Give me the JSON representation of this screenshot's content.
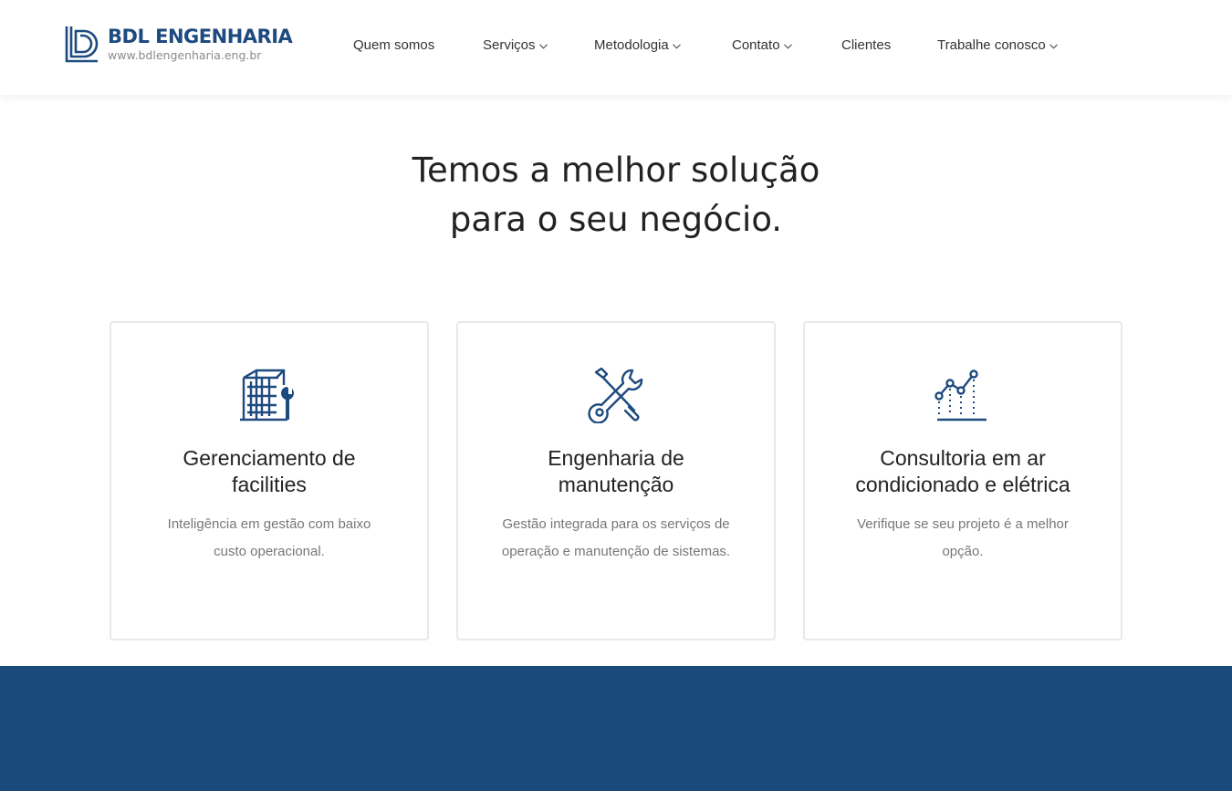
{
  "brand": {
    "name": "BDL ENGENHARIA",
    "url": "www.bdlengenharia.eng.br",
    "color": "#1d4a7f"
  },
  "nav": {
    "items": [
      {
        "label": "Quem somos",
        "dropdown": false
      },
      {
        "label": "Serviços",
        "dropdown": true
      },
      {
        "label": "Metodologia",
        "dropdown": true
      },
      {
        "label": "Contato",
        "dropdown": true
      },
      {
        "label": "Clientes",
        "dropdown": false
      },
      {
        "label": "Trabalhe conosco",
        "dropdown": true
      }
    ]
  },
  "hero": {
    "line1": "Temos a melhor solução",
    "line2": "para o seu negócio."
  },
  "cards": [
    {
      "icon": "building-wrench-icon",
      "title_line1": "Gerenciamento de",
      "title_line2": "facilities",
      "desc_line1": "Inteligência em gestão com baixo",
      "desc_line2": "custo operacional."
    },
    {
      "icon": "tools-icon",
      "title_line1": "Engenharia de",
      "title_line2": "manutenção",
      "desc_line1": "Gestão integrada para os serviços de",
      "desc_line2": "operação e manutenção de sistemas."
    },
    {
      "icon": "line-chart-icon",
      "title_line1": "Consultoria em ar",
      "title_line2": "condicionado e elétrica",
      "desc_line1": "Verifique se seu projeto é a melhor",
      "desc_line2": "opção."
    }
  ],
  "colors": {
    "accent": "#1d4a7f",
    "band": "#1a4a7c"
  }
}
